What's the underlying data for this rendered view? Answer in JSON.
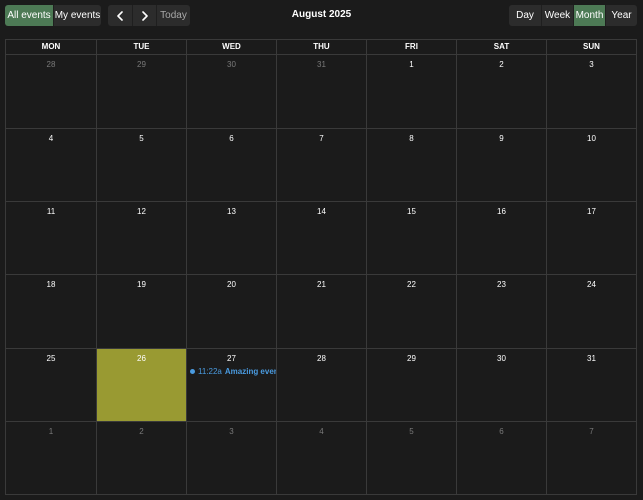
{
  "toolbar": {
    "filters": [
      {
        "label": "All events",
        "active": true
      },
      {
        "label": "My events",
        "active": false
      }
    ],
    "nav": {
      "prev_icon": "chevron-left-icon",
      "next_icon": "chevron-right-icon",
      "today_label": "Today"
    },
    "title": "August 2025",
    "views": [
      {
        "label": "Day",
        "active": false
      },
      {
        "label": "Week",
        "active": false
      },
      {
        "label": "Month",
        "active": true
      },
      {
        "label": "Year",
        "active": false
      }
    ]
  },
  "calendar": {
    "weekdays": [
      "MON",
      "TUE",
      "WED",
      "THU",
      "FRI",
      "SAT",
      "SUN"
    ],
    "weeks": [
      [
        {
          "d": "28",
          "other": true
        },
        {
          "d": "29",
          "other": true
        },
        {
          "d": "30",
          "other": true
        },
        {
          "d": "31",
          "other": true
        },
        {
          "d": "1"
        },
        {
          "d": "2"
        },
        {
          "d": "3"
        }
      ],
      [
        {
          "d": "4"
        },
        {
          "d": "5"
        },
        {
          "d": "6"
        },
        {
          "d": "7"
        },
        {
          "d": "8"
        },
        {
          "d": "9"
        },
        {
          "d": "10"
        }
      ],
      [
        {
          "d": "11"
        },
        {
          "d": "12"
        },
        {
          "d": "13"
        },
        {
          "d": "14"
        },
        {
          "d": "15"
        },
        {
          "d": "16"
        },
        {
          "d": "17"
        }
      ],
      [
        {
          "d": "18"
        },
        {
          "d": "19"
        },
        {
          "d": "20"
        },
        {
          "d": "21"
        },
        {
          "d": "22"
        },
        {
          "d": "23"
        },
        {
          "d": "24"
        }
      ],
      [
        {
          "d": "25"
        },
        {
          "d": "26",
          "today": true
        },
        {
          "d": "27",
          "events": [
            {
              "time": "11:22a",
              "title": "Amazing event"
            }
          ]
        },
        {
          "d": "28"
        },
        {
          "d": "29"
        },
        {
          "d": "30"
        },
        {
          "d": "31"
        }
      ],
      [
        {
          "d": "1",
          "other": true
        },
        {
          "d": "2",
          "other": true
        },
        {
          "d": "3",
          "other": true
        },
        {
          "d": "4",
          "other": true
        },
        {
          "d": "5",
          "other": true
        },
        {
          "d": "6",
          "other": true
        },
        {
          "d": "7",
          "other": true
        }
      ]
    ]
  },
  "colors": {
    "background": "#1b1b1b",
    "button": "#2c2c2c",
    "active": "#4d7a55",
    "today": "#999a32",
    "event": "#4a9be0",
    "grid": "#3a3a3a"
  }
}
